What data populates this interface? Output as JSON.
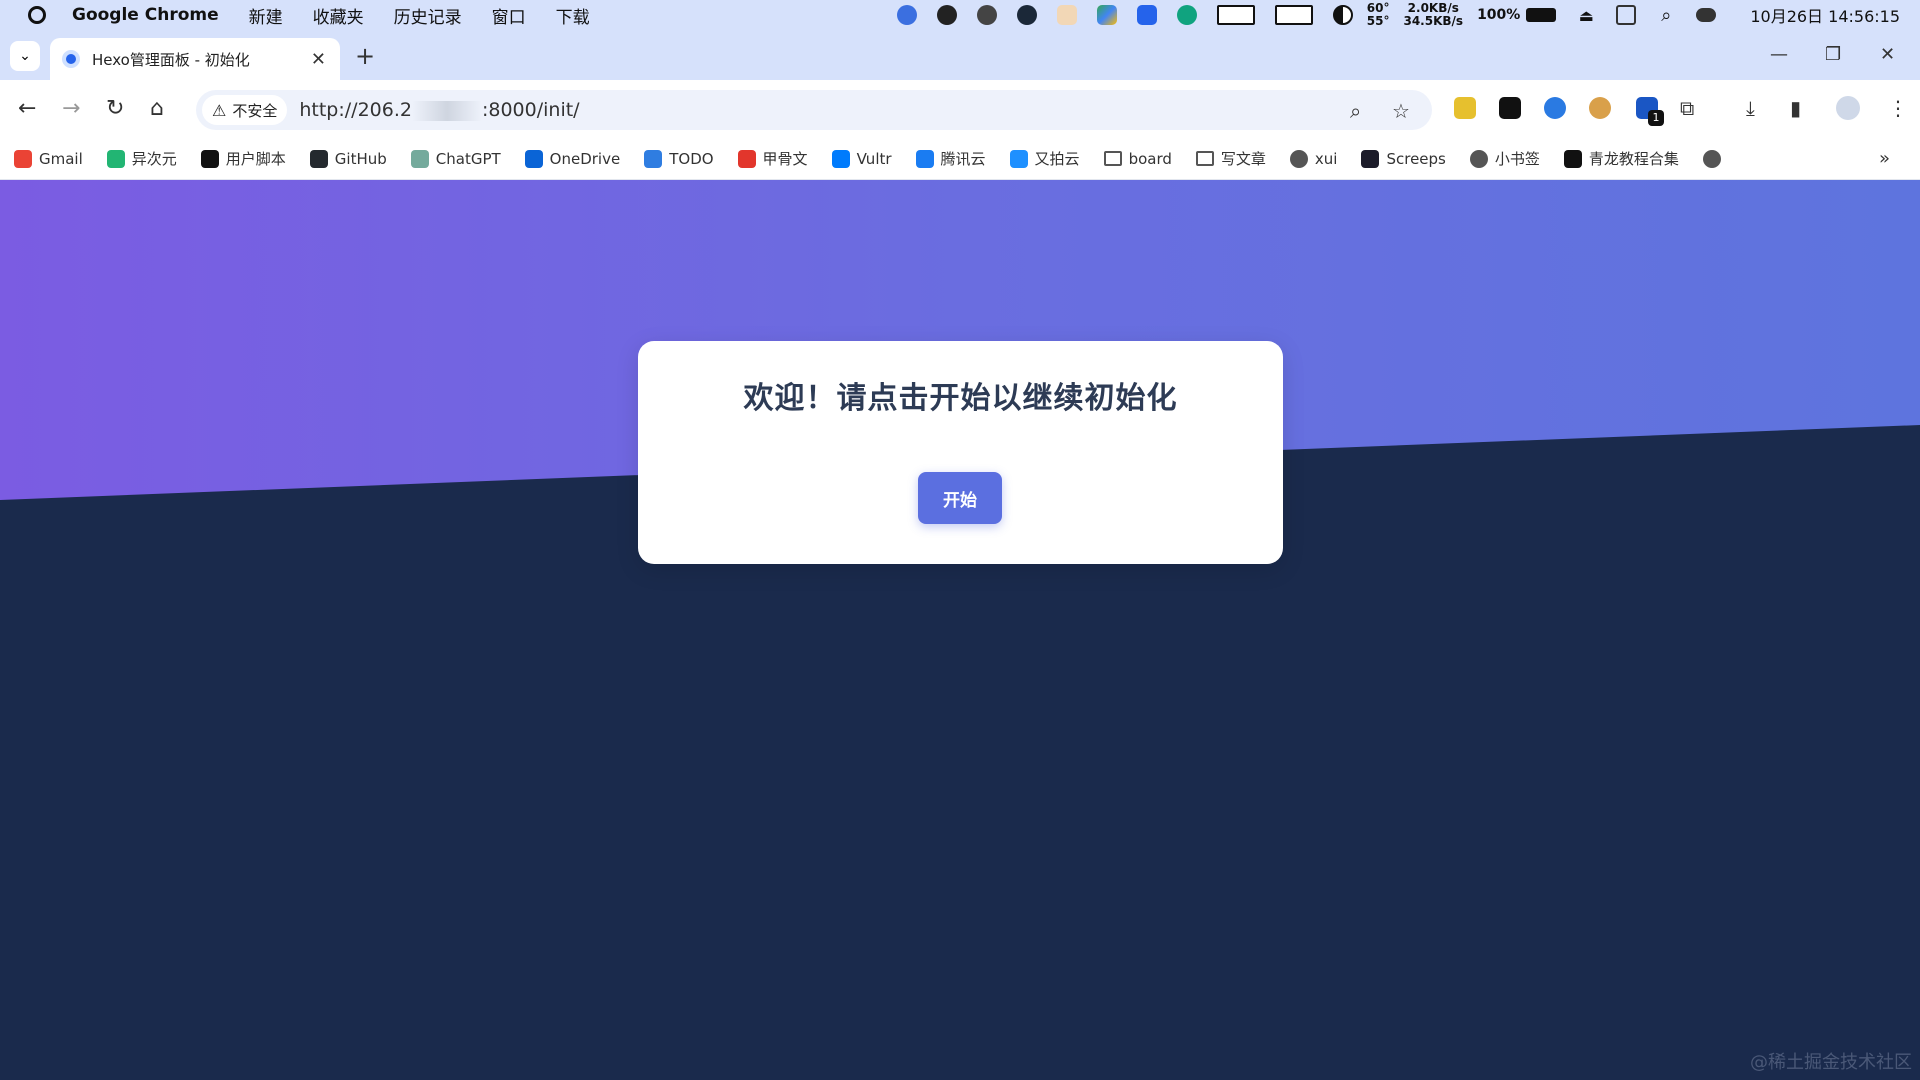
{
  "menubar": {
    "app_name": "Google Chrome",
    "menus": [
      "新建",
      "收藏夹",
      "历史记录",
      "窗口",
      "下载"
    ],
    "network_up": "2.0KB/s",
    "network_down": "34.5KB/s",
    "temp_top": "60°",
    "temp_bottom": "55°",
    "battery": "100%",
    "clock": "10月26日 14:56:15"
  },
  "tab": {
    "title": "Hexo管理面板 - 初始化",
    "close": "✕",
    "new_tab": "+"
  },
  "window_controls": {
    "minimize": "—",
    "restore": "❐",
    "close": "✕"
  },
  "toolbar": {
    "security_label": "不安全",
    "url_prefix": "http://206.2",
    "url_suffix": ":8000/init/",
    "extension_badge": "1"
  },
  "bookmarks": [
    {
      "label": "Gmail",
      "icon": "gmail-icon",
      "color": "#ea4335"
    },
    {
      "label": "异次元",
      "icon": "yicy-icon",
      "color": "#22b573"
    },
    {
      "label": "用户脚本",
      "icon": "userscript-icon",
      "color": "#111111"
    },
    {
      "label": "GitHub",
      "icon": "github-icon",
      "color": "#24292e"
    },
    {
      "label": "ChatGPT",
      "icon": "chatgpt-icon",
      "color": "#74aa9c"
    },
    {
      "label": "OneDrive",
      "icon": "onedrive-icon",
      "color": "#0a64d6"
    },
    {
      "label": "TODO",
      "icon": "todo-icon",
      "color": "#2f7de1"
    },
    {
      "label": "甲骨文",
      "icon": "oracle-icon",
      "color": "#e2362c"
    },
    {
      "label": "Vultr",
      "icon": "vultr-icon",
      "color": "#007bfc"
    },
    {
      "label": "腾讯云",
      "icon": "tencent-cloud-icon",
      "color": "#1a7cf2"
    },
    {
      "label": "又拍云",
      "icon": "upyun-icon",
      "color": "#1e90ff"
    },
    {
      "label": "board",
      "icon": "folder-icon",
      "color": "#555555"
    },
    {
      "label": "写文章",
      "icon": "folder-icon",
      "color": "#555555"
    },
    {
      "label": "xui",
      "icon": "globe-icon",
      "color": "#555555"
    },
    {
      "label": "Screeps",
      "icon": "screeps-icon",
      "color": "#1c1c2a"
    },
    {
      "label": "小书签",
      "icon": "globe-icon",
      "color": "#555555"
    },
    {
      "label": "青龙教程合集",
      "icon": "notion-icon",
      "color": "#111111"
    }
  ],
  "page": {
    "heading": "欢迎！请点击开始以继续初始化",
    "start_button": "开始",
    "watermark": "@稀土掘金技术社区"
  },
  "colors": {
    "gradient_start": "#7b5ce2",
    "gradient_end": "#5e74de",
    "dark_bg": "#1a2a4c",
    "button": "#5b6fe0",
    "chrome_frame": "#d6e1fb"
  }
}
